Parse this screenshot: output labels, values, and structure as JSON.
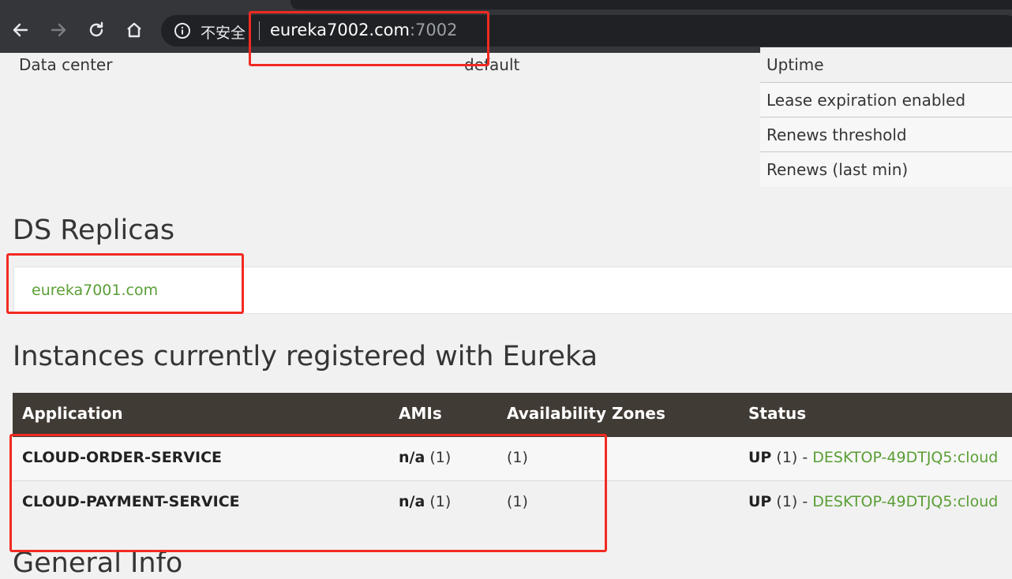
{
  "browser": {
    "security_label": "不安全",
    "url_host": "eureka7002.com",
    "url_port": ":7002"
  },
  "system_status": {
    "data_center_label": "Data center",
    "data_center_value": "default",
    "stats_labels": [
      "Uptime",
      "Lease expiration enabled",
      "Renews threshold",
      "Renews (last min)"
    ]
  },
  "ds_replicas": {
    "title": "DS Replicas",
    "items": [
      "eureka7001.com"
    ]
  },
  "instances": {
    "title": "Instances currently registered with Eureka",
    "headers": [
      "Application",
      "AMIs",
      "Availability Zones",
      "Status"
    ],
    "rows": [
      {
        "application": "CLOUD-ORDER-SERVICE",
        "amis_bold": "n/a",
        "amis_count": "(1)",
        "zones": "(1)",
        "status_bold": "UP",
        "status_count": "(1) -",
        "status_link": "DESKTOP-49DTJQ5:cloud"
      },
      {
        "application": "CLOUD-PAYMENT-SERVICE",
        "amis_bold": "n/a",
        "amis_count": "(1)",
        "zones": "(1)",
        "status_bold": "UP",
        "status_count": "(1) -",
        "status_link": "DESKTOP-49DTJQ5:cloud"
      }
    ]
  },
  "general_info": {
    "title": "General Info"
  },
  "colors": {
    "table_header": "#413b35",
    "link_green": "#5a9e35",
    "annotation_red": "#f22a22"
  }
}
